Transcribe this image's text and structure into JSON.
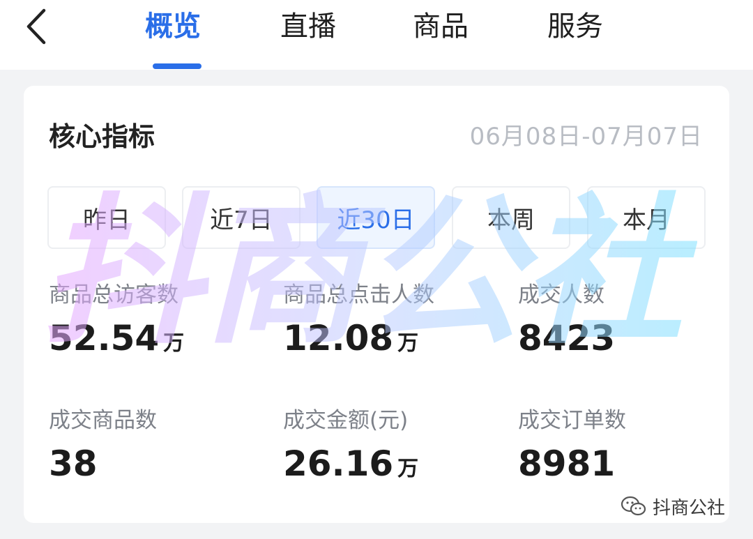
{
  "nav": {
    "back_icon": "chevron-left-icon",
    "tabs": [
      {
        "label": "概览",
        "active": true
      },
      {
        "label": "直播",
        "active": false
      },
      {
        "label": "商品",
        "active": false
      },
      {
        "label": "服务",
        "active": false
      }
    ],
    "active_color": "#2a6ee8"
  },
  "card": {
    "title": "核心指标",
    "date_range": "06月08日-07月07日",
    "filters": [
      {
        "label": "昨日",
        "active": false
      },
      {
        "label": "近7日",
        "active": false
      },
      {
        "label": "近30日",
        "active": true
      },
      {
        "label": "本周",
        "active": false
      },
      {
        "label": "本月",
        "active": false
      }
    ],
    "metrics": [
      {
        "label": "商品总访客数",
        "value": "52.54",
        "unit": "万"
      },
      {
        "label": "商品总点击人数",
        "value": "12.08",
        "unit": "万"
      },
      {
        "label": "成交人数",
        "value": "8423",
        "unit": ""
      },
      {
        "label": "成交商品数",
        "value": "38",
        "unit": ""
      },
      {
        "label": "成交金额(元)",
        "value": "26.16",
        "unit": "万"
      },
      {
        "label": "成交订单数",
        "value": "8981",
        "unit": ""
      }
    ]
  },
  "watermark": {
    "text": "抖商公社",
    "source_label": "抖商公社",
    "source_icon": "wechat-icon"
  }
}
